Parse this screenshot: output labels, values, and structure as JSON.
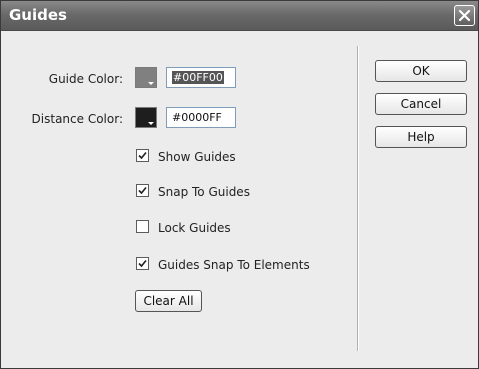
{
  "window": {
    "title": "Guides"
  },
  "guide_color": {
    "label": "Guide Color:",
    "swatch_color": "#808080",
    "value": "#00FF00"
  },
  "distance_color": {
    "label": "Distance Color:",
    "swatch_color": "#1e1e1e",
    "value": "#0000FF"
  },
  "options": [
    {
      "label": "Show Guides",
      "checked": true
    },
    {
      "label": "Snap To Guides",
      "checked": true
    },
    {
      "label": "Lock Guides",
      "checked": false
    },
    {
      "label": "Guides Snap To Elements",
      "checked": true
    }
  ],
  "clear_all_label": "Clear All",
  "buttons": {
    "ok": "OK",
    "cancel": "Cancel",
    "help": "Help"
  },
  "icons": {
    "close": "close-icon",
    "checkmark": "checkmark-icon",
    "dropdown": "dropdown-arrow-icon"
  }
}
